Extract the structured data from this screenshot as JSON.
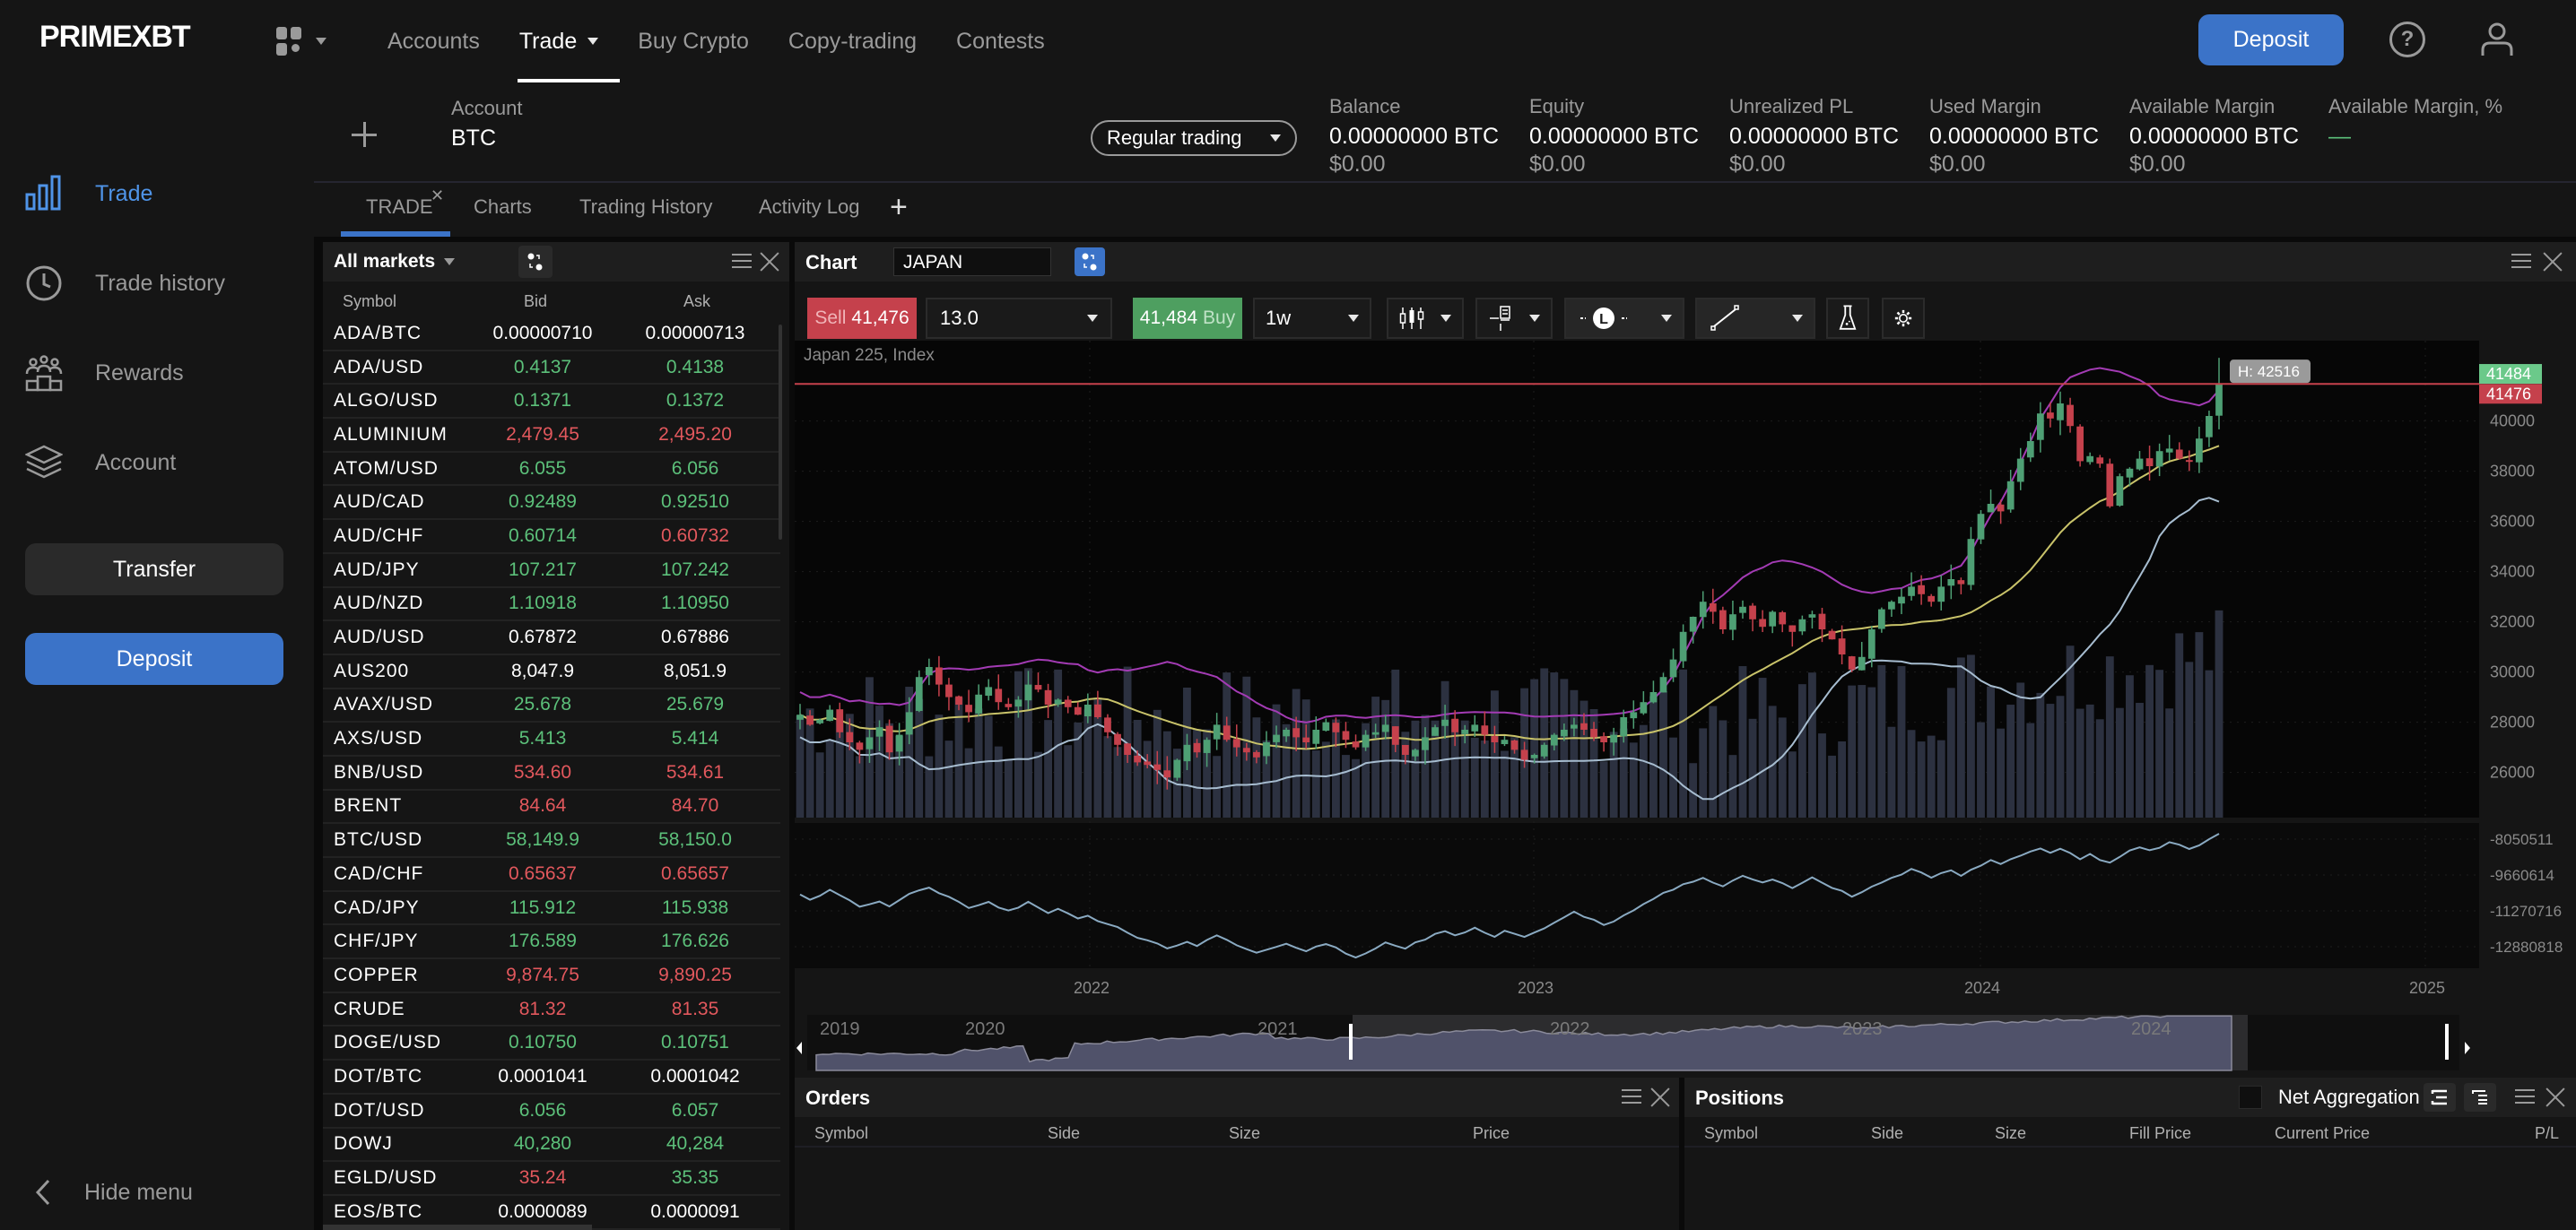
{
  "brand": "PRIMEXBT",
  "topnav": {
    "items": [
      {
        "label": "Accounts",
        "active": false,
        "dropdown": false
      },
      {
        "label": "Trade",
        "active": true,
        "dropdown": true
      },
      {
        "label": "Buy Crypto",
        "active": false,
        "dropdown": false
      },
      {
        "label": "Copy-trading",
        "active": false,
        "dropdown": false
      },
      {
        "label": "Contests",
        "active": false,
        "dropdown": false
      }
    ],
    "deposit_label": "Deposit",
    "help_icon": "question-circle-icon",
    "user_icon": "user-icon"
  },
  "sidebar": {
    "items": [
      {
        "label": "Trade",
        "icon": "bar-chart-icon",
        "active": true
      },
      {
        "label": "Trade history",
        "icon": "clock-icon",
        "active": false
      },
      {
        "label": "Rewards",
        "icon": "people-podium-icon",
        "active": false
      },
      {
        "label": "Account",
        "icon": "layers-icon",
        "active": false
      }
    ],
    "transfer_label": "Transfer",
    "deposit_label": "Deposit",
    "hide_menu_label": "Hide menu"
  },
  "account_bar": {
    "account_label": "Account",
    "account_value": "BTC",
    "mode": "Regular trading",
    "stats": [
      {
        "label": "Balance",
        "value": "0.00000000 BTC",
        "usd": "$0.00"
      },
      {
        "label": "Equity",
        "value": "0.00000000 BTC",
        "usd": "$0.00"
      },
      {
        "label": "Unrealized PL",
        "value": "0.00000000 BTC",
        "usd": "$0.00"
      },
      {
        "label": "Used Margin",
        "value": "0.00000000 BTC",
        "usd": "$0.00"
      },
      {
        "label": "Available Margin",
        "value": "0.00000000 BTC",
        "usd": "$0.00"
      },
      {
        "label": "Available Margin, %",
        "value": "—",
        "usd": ""
      }
    ]
  },
  "worktabs": [
    {
      "label": "TRADE",
      "active": true,
      "closable": true
    },
    {
      "label": "Charts",
      "active": false
    },
    {
      "label": "Trading History",
      "active": false
    },
    {
      "label": "Activity Log",
      "active": false
    }
  ],
  "markets": {
    "filter": "All markets",
    "columns": [
      "Symbol",
      "Bid",
      "Ask"
    ],
    "rows": [
      {
        "symbol": "ADA/BTC",
        "bid": "0.00000710",
        "ask": "0.00000713",
        "bid_dir": "nt",
        "ask_dir": "nt"
      },
      {
        "symbol": "ADA/USD",
        "bid": "0.4137",
        "ask": "0.4138",
        "bid_dir": "up",
        "ask_dir": "up"
      },
      {
        "symbol": "ALGO/USD",
        "bid": "0.1371",
        "ask": "0.1372",
        "bid_dir": "up",
        "ask_dir": "up"
      },
      {
        "symbol": "ALUMINIUM",
        "bid": "2,479.45",
        "ask": "2,495.20",
        "bid_dir": "dn",
        "ask_dir": "dn"
      },
      {
        "symbol": "ATOM/USD",
        "bid": "6.055",
        "ask": "6.056",
        "bid_dir": "up",
        "ask_dir": "up"
      },
      {
        "symbol": "AUD/CAD",
        "bid": "0.92489",
        "ask": "0.92510",
        "bid_dir": "up",
        "ask_dir": "up"
      },
      {
        "symbol": "AUD/CHF",
        "bid": "0.60714",
        "ask": "0.60732",
        "bid_dir": "up",
        "ask_dir": "dn"
      },
      {
        "symbol": "AUD/JPY",
        "bid": "107.217",
        "ask": "107.242",
        "bid_dir": "up",
        "ask_dir": "up"
      },
      {
        "symbol": "AUD/NZD",
        "bid": "1.10918",
        "ask": "1.10950",
        "bid_dir": "up",
        "ask_dir": "up"
      },
      {
        "symbol": "AUD/USD",
        "bid": "0.67872",
        "ask": "0.67886",
        "bid_dir": "nt",
        "ask_dir": "nt"
      },
      {
        "symbol": "AUS200",
        "bid": "8,047.9",
        "ask": "8,051.9",
        "bid_dir": "nt",
        "ask_dir": "nt"
      },
      {
        "symbol": "AVAX/USD",
        "bid": "25.678",
        "ask": "25.679",
        "bid_dir": "up",
        "ask_dir": "up"
      },
      {
        "symbol": "AXS/USD",
        "bid": "5.413",
        "ask": "5.414",
        "bid_dir": "up",
        "ask_dir": "up"
      },
      {
        "symbol": "BNB/USD",
        "bid": "534.60",
        "ask": "534.61",
        "bid_dir": "dn",
        "ask_dir": "dn"
      },
      {
        "symbol": "BRENT",
        "bid": "84.64",
        "ask": "84.70",
        "bid_dir": "dn",
        "ask_dir": "dn"
      },
      {
        "symbol": "BTC/USD",
        "bid": "58,149.9",
        "ask": "58,150.0",
        "bid_dir": "up",
        "ask_dir": "up"
      },
      {
        "symbol": "CAD/CHF",
        "bid": "0.65637",
        "ask": "0.65657",
        "bid_dir": "dn",
        "ask_dir": "dn"
      },
      {
        "symbol": "CAD/JPY",
        "bid": "115.912",
        "ask": "115.938",
        "bid_dir": "up",
        "ask_dir": "up"
      },
      {
        "symbol": "CHF/JPY",
        "bid": "176.589",
        "ask": "176.626",
        "bid_dir": "up",
        "ask_dir": "up"
      },
      {
        "symbol": "COPPER",
        "bid": "9,874.75",
        "ask": "9,890.25",
        "bid_dir": "dn",
        "ask_dir": "dn"
      },
      {
        "symbol": "CRUDE",
        "bid": "81.32",
        "ask": "81.35",
        "bid_dir": "dn",
        "ask_dir": "dn"
      },
      {
        "symbol": "DOGE/USD",
        "bid": "0.10750",
        "ask": "0.10751",
        "bid_dir": "up",
        "ask_dir": "up"
      },
      {
        "symbol": "DOT/BTC",
        "bid": "0.0001041",
        "ask": "0.0001042",
        "bid_dir": "nt",
        "ask_dir": "nt"
      },
      {
        "symbol": "DOT/USD",
        "bid": "6.056",
        "ask": "6.057",
        "bid_dir": "up",
        "ask_dir": "up"
      },
      {
        "symbol": "DOWJ",
        "bid": "40,280",
        "ask": "40,284",
        "bid_dir": "up",
        "ask_dir": "up"
      },
      {
        "symbol": "EGLD/USD",
        "bid": "35.24",
        "ask": "35.35",
        "bid_dir": "dn",
        "ask_dir": "up"
      },
      {
        "symbol": "EOS/BTC",
        "bid": "0.0000089",
        "ask": "0.0000091",
        "bid_dir": "nt",
        "ask_dir": "nt"
      }
    ]
  },
  "chart_panel": {
    "title": "Chart",
    "symbol": "JAPAN",
    "sell_label": "Sell",
    "sell_price": "41,476",
    "quantity": "13.0",
    "buy_price": "41,484",
    "buy_label": "Buy",
    "timeframe": "1w",
    "tools": [
      "candlestick-icon",
      "indicator-icon",
      "line-style-icon",
      "draw-line-icon",
      "flask-icon",
      "gear-icon"
    ]
  },
  "chart_data": {
    "type": "candlestick",
    "title": "Japan 225, Index",
    "timeframe": "1w",
    "ask_price": 41484,
    "bid_price": 41476,
    "high_marker": "H: 42516",
    "high_value": 42516,
    "price_axis": {
      "ticks": [
        26000,
        28000,
        30000,
        32000,
        34000,
        36000,
        38000,
        40000
      ],
      "range": [
        24200,
        43200
      ]
    },
    "indicator_axis": {
      "ticks": [
        -8050511,
        -9660614,
        -11270716,
        -12880818
      ]
    },
    "x_ticks": [
      "2022",
      "2023",
      "2024",
      "2025"
    ],
    "navigator_ticks": [
      "2019",
      "2020",
      "2021",
      "2022",
      "2023",
      "2024"
    ],
    "colors": {
      "up": "#4e9f74",
      "down": "#c5414c",
      "upper_band": "#a33bb4",
      "middle_band": "#c9c36a",
      "lower_band": "#a7bdd0",
      "volume": "#2c3140",
      "bid_line": "#c5414c",
      "indicator": "#8aaac2"
    },
    "close_series": [
      28300,
      27900,
      28100,
      28500,
      27600,
      27200,
      26900,
      27400,
      27800,
      26800,
      27500,
      28400,
      29800,
      30200,
      29500,
      29000,
      28700,
      28400,
      29100,
      29400,
      28800,
      28600,
      28900,
      29500,
      29300,
      28700,
      28900,
      28600,
      28300,
      28700,
      28200,
      27600,
      27100,
      26700,
      26400,
      26300,
      26100,
      25800,
      26500,
      27100,
      26800,
      27300,
      27900,
      27300,
      27000,
      26800,
      26600,
      27200,
      27500,
      27700,
      27400,
      27200,
      27700,
      28000,
      27600,
      27300,
      27000,
      27500,
      27600,
      27900,
      27100,
      26700,
      26900,
      27400,
      27800,
      28100,
      27600,
      27700,
      27900,
      27500,
      27200,
      27300,
      26900,
      26500,
      26700,
      27100,
      27500,
      27700,
      27900,
      27700,
      27400,
      27200,
      27500,
      28200,
      28400,
      28800,
      29200,
      29800,
      30500,
      31600,
      32200,
      32800,
      32400,
      31700,
      32300,
      32600,
      32100,
      31800,
      32400,
      31900,
      31600,
      32100,
      32300,
      31700,
      31300,
      30700,
      30100,
      30600,
      31700,
      32500,
      32800,
      33000,
      33400,
      33100,
      32800,
      33400,
      33700,
      33500,
      35300,
      36300,
      36700,
      36400,
      37600,
      38500,
      39200,
      40300,
      40100,
      40700,
      39800,
      38400,
      38600,
      38300,
      36600,
      37800,
      38100,
      38500,
      38200,
      38800,
      38900,
      38500,
      38400,
      39300,
      40200,
      41480
    ],
    "sma_series": [
      28200,
      28200,
      28250,
      28300,
      28250,
      28100,
      27900,
      27800,
      27900,
      28100,
      28300,
      28600,
      28800,
      28800,
      28700,
      28600,
      28600,
      28500,
      28500,
      28400,
      28200,
      28000,
      27800,
      27600,
      27400,
      27200,
      27100,
      27000,
      26900,
      26900,
      26900,
      27000,
      27000,
      27000,
      27000,
      27100,
      27100,
      27200,
      27200,
      27300,
      27300,
      27400,
      27400,
      27600,
      27800,
      28000,
      28200,
      28300,
      28500,
      28700,
      28900,
      29100,
      29300,
      29500,
      29700,
      29900,
      30100,
      30400,
      30700,
      31000,
      31200,
      31400,
      31500,
      31600,
      31700,
      31800,
      32000,
      32200,
      32400,
      32600,
      32800,
      33000,
      33200,
      33500,
      33800,
      34200,
      34600,
      35000,
      35400,
      35800,
      36200,
      36500,
      36700,
      36800,
      37000,
      37200,
      37400,
      37700,
      37800,
      37900,
      38000,
      38100,
      38300,
      38600,
      38900
    ]
  },
  "orders": {
    "title": "Orders",
    "columns": [
      "Symbol",
      "Side",
      "Size",
      "Price"
    ]
  },
  "positions": {
    "title": "Positions",
    "net_aggregation_label": "Net Aggregation",
    "columns": [
      "Symbol",
      "Side",
      "Size",
      "Fill Price",
      "Current Price",
      "P/L"
    ]
  }
}
